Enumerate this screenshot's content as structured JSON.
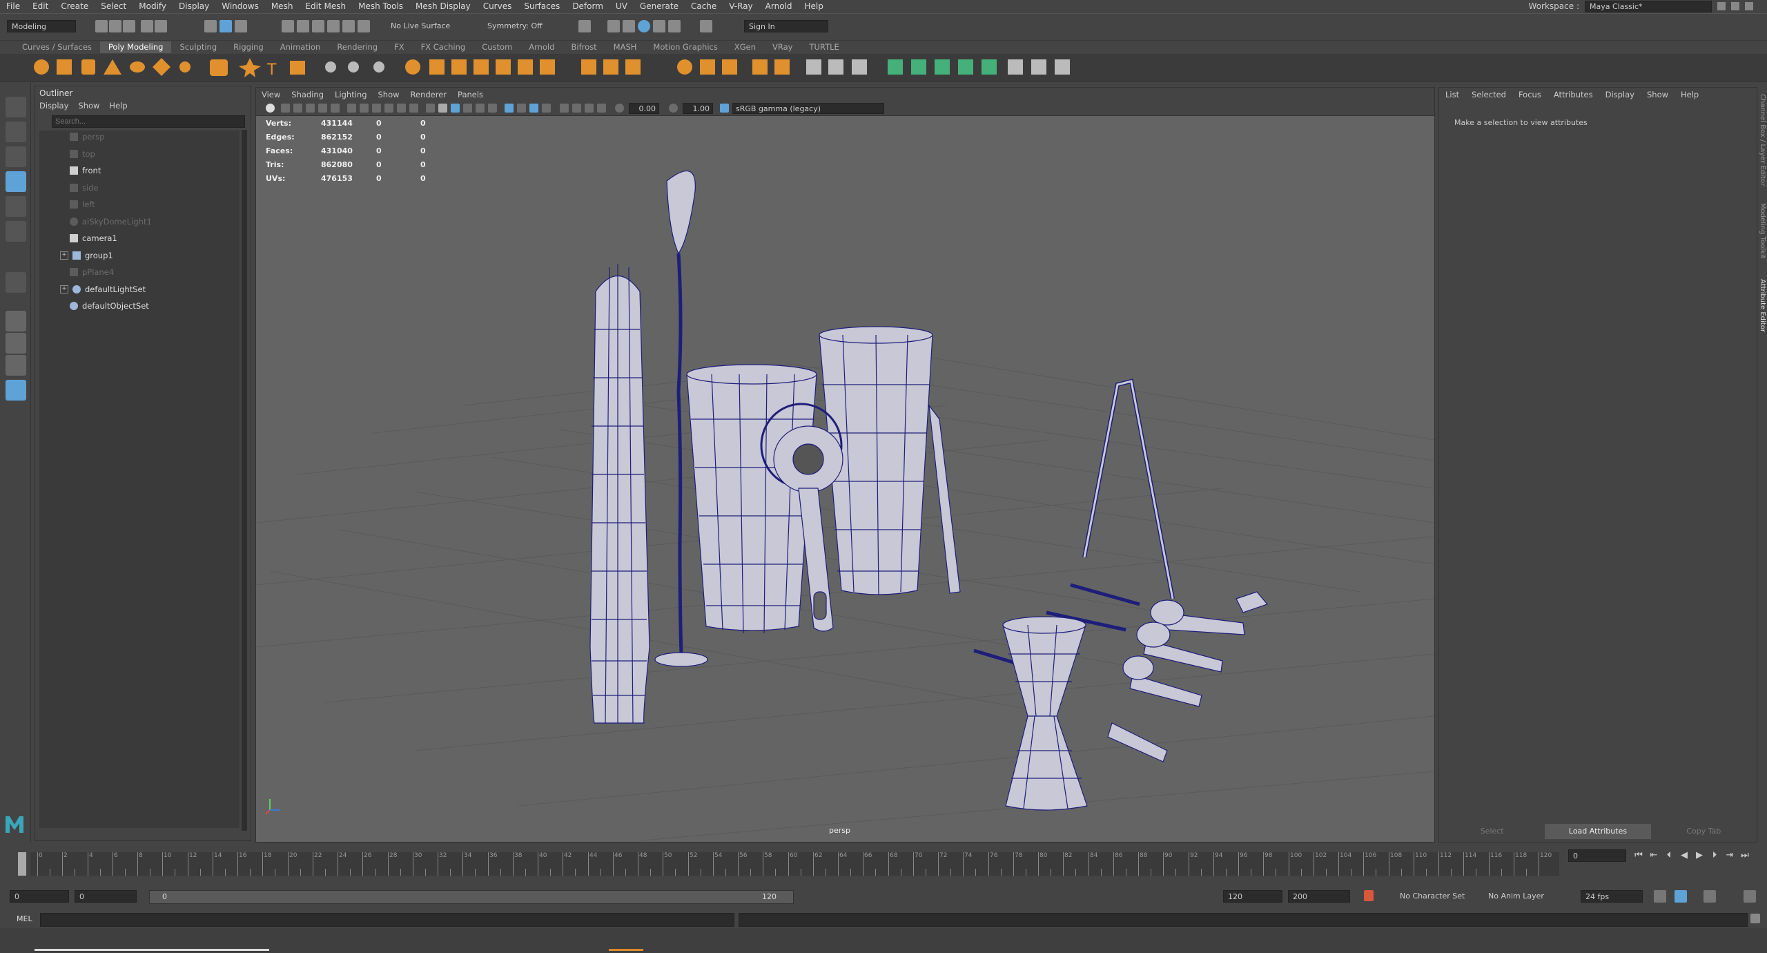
{
  "menubar": [
    "File",
    "Edit",
    "Create",
    "Select",
    "Modify",
    "Display",
    "Windows",
    "Mesh",
    "Edit Mesh",
    "Mesh Tools",
    "Mesh Display",
    "Curves",
    "Surfaces",
    "Deform",
    "UV",
    "Generate",
    "Cache",
    "V-Ray",
    "Arnold",
    "Help"
  ],
  "workspace": {
    "label": "Workspace :",
    "value": "Maya Classic*"
  },
  "status": {
    "mode": "Modeling",
    "live_surface": "No Live Surface",
    "symmetry": "Symmetry: Off",
    "sign_in": "Sign In"
  },
  "shelf_tabs": [
    "Curves / Surfaces",
    "Poly Modeling",
    "Sculpting",
    "Rigging",
    "Animation",
    "Rendering",
    "FX",
    "FX Caching",
    "Custom",
    "Arnold",
    "Bifrost",
    "MASH",
    "Motion Graphics",
    "XGen",
    "VRay",
    "TURTLE"
  ],
  "shelf_active": "Poly Modeling",
  "outliner": {
    "title": "Outliner",
    "menu": [
      "Display",
      "Show",
      "Help"
    ],
    "search_placeholder": "Search...",
    "items": [
      {
        "label": "persp",
        "dim": true,
        "type": "camera"
      },
      {
        "label": "top",
        "dim": true,
        "type": "camera"
      },
      {
        "label": "front",
        "dim": false,
        "type": "camera"
      },
      {
        "label": "side",
        "dim": true,
        "type": "camera"
      },
      {
        "label": "left",
        "dim": true,
        "type": "camera"
      },
      {
        "label": "aiSkyDomeLight1",
        "dim": true,
        "type": "light"
      },
      {
        "label": "camera1",
        "dim": false,
        "type": "camera"
      },
      {
        "label": "group1",
        "dim": false,
        "type": "group",
        "expandable": true
      },
      {
        "label": "pPlane4",
        "dim": true,
        "type": "mesh"
      },
      {
        "label": "defaultLightSet",
        "dim": false,
        "type": "set",
        "expandable": true
      },
      {
        "label": "defaultObjectSet",
        "dim": false,
        "type": "set"
      }
    ]
  },
  "viewport": {
    "menu": [
      "View",
      "Shading",
      "Lighting",
      "Show",
      "Renderer",
      "Panels"
    ],
    "exposure": "0.00",
    "gamma": "1.00",
    "colorspace": "sRGB gamma (legacy)",
    "camera": "persp",
    "hud": [
      {
        "k": "Verts:",
        "v": "431144",
        "a": "0",
        "b": "0"
      },
      {
        "k": "Edges:",
        "v": "862152",
        "a": "0",
        "b": "0"
      },
      {
        "k": "Faces:",
        "v": "431040",
        "a": "0",
        "b": "0"
      },
      {
        "k": "Tris:",
        "v": "862080",
        "a": "0",
        "b": "0"
      },
      {
        "k": "UVs:",
        "v": "476153",
        "a": "0",
        "b": "0"
      }
    ]
  },
  "attribute_editor": {
    "menu": [
      "List",
      "Selected",
      "Focus",
      "Attributes",
      "Display",
      "Show",
      "Help"
    ],
    "message": "Make a selection to view attributes",
    "buttons": [
      "Select",
      "Load Attributes",
      "Copy Tab"
    ],
    "side_tabs": [
      "Channel Box / Layer Editor",
      "Modeling Toolkit",
      "Attribute Editor"
    ]
  },
  "timeline": {
    "ticks": [
      "0",
      "2",
      "4",
      "6",
      "8",
      "10",
      "12",
      "14",
      "16",
      "18",
      "20",
      "22",
      "24",
      "26",
      "28",
      "30",
      "32",
      "34",
      "36",
      "38",
      "40",
      "42",
      "44",
      "46",
      "48",
      "50",
      "52",
      "54",
      "56",
      "58",
      "60",
      "62",
      "64",
      "66",
      "68",
      "70",
      "72",
      "74",
      "76",
      "78",
      "80",
      "82",
      "84",
      "86",
      "88",
      "90",
      "92",
      "94",
      "96",
      "98",
      "100",
      "102",
      "104",
      "106",
      "108",
      "110",
      "112",
      "114",
      "116",
      "118",
      "120"
    ],
    "current": "0"
  },
  "range": {
    "start": "0",
    "start2": "0",
    "slider_start": "0",
    "slider_end": "120",
    "end": "120",
    "end2": "200",
    "character_set": "No Character Set",
    "anim_layer": "No Anim Layer",
    "fps": "24 fps"
  },
  "command_line": {
    "label": "MEL"
  }
}
